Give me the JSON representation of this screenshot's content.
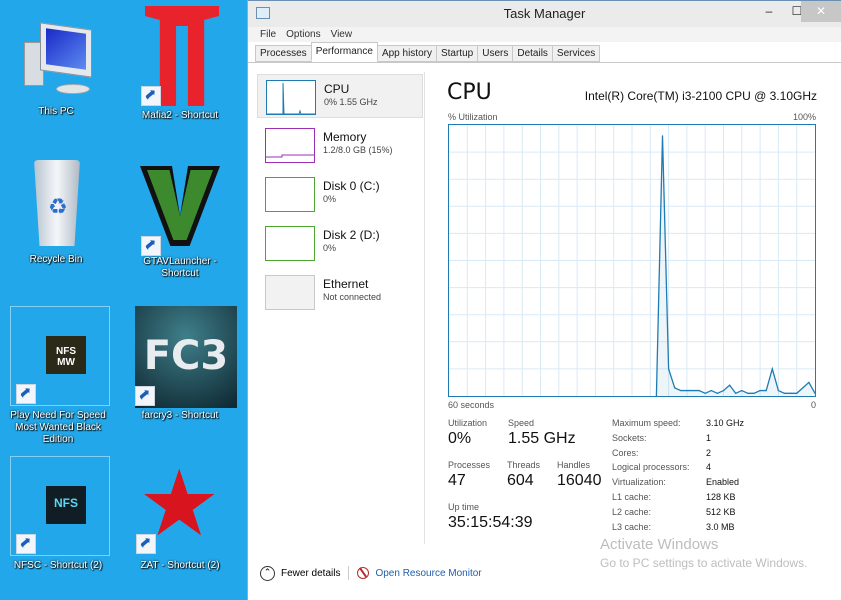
{
  "desktop": {
    "icons": [
      {
        "label": "This PC",
        "icon": "this-pc-icon"
      },
      {
        "label": "Mafia2 - Shortcut",
        "icon": "mafia2-icon"
      },
      {
        "label": "Recycle Bin",
        "icon": "recycle-bin-icon"
      },
      {
        "label": "GTAVLauncher - Shortcut",
        "icon": "gtav-icon"
      },
      {
        "label": "Play Need For Speed Most Wanted Black Edition",
        "icon": "nfs-mw-icon",
        "thumb_text": "NFS MW"
      },
      {
        "label": "farcry3 - Shortcut",
        "icon": "farcry3-icon",
        "thumb_text": "FC3"
      },
      {
        "label": "NFSC - Shortcut (2)",
        "icon": "nfsc-icon",
        "thumb_text": "NFS"
      },
      {
        "label": "ZAT - Shortcut (2)",
        "icon": "pentagram-icon"
      }
    ]
  },
  "window": {
    "title": "Task Manager",
    "controls": {
      "minimize": "–",
      "maximize": "☐",
      "close": "✕"
    },
    "menu": [
      "File",
      "Options",
      "View"
    ],
    "tabs": [
      "Processes",
      "Performance",
      "App history",
      "Startup",
      "Users",
      "Details",
      "Services"
    ],
    "active_tab": "Performance"
  },
  "resources": [
    {
      "name": "CPU",
      "sub": "0% 1.55 GHz",
      "color": "#1e7bb4"
    },
    {
      "name": "Memory",
      "sub": "1.2/8.0 GB (15%)",
      "color": "#9b30b4"
    },
    {
      "name": "Disk 0 (C:)",
      "sub": "0%",
      "color": "#4da62f"
    },
    {
      "name": "Disk 2 (D:)",
      "sub": "0%",
      "color": "#4da62f"
    },
    {
      "name": "Ethernet",
      "sub": "Not connected",
      "color": "#c8c8c8"
    }
  ],
  "cpu": {
    "heading": "CPU",
    "model": "Intel(R) Core(TM) i3-2100 CPU @ 3.10GHz",
    "y_label": "% Utilization",
    "y_max_label": "100%",
    "x_left_label": "60 seconds",
    "x_right_label": "0",
    "stats": {
      "utilization": {
        "label": "Utilization",
        "value": "0%"
      },
      "speed": {
        "label": "Speed",
        "value": "1.55 GHz"
      },
      "processes": {
        "label": "Processes",
        "value": "47"
      },
      "threads": {
        "label": "Threads",
        "value": "604"
      },
      "handles": {
        "label": "Handles",
        "value": "16040"
      },
      "uptime": {
        "label": "Up time",
        "value": "35:15:54:39"
      }
    },
    "specs": [
      {
        "k": "Maximum speed:",
        "v": "3.10 GHz"
      },
      {
        "k": "Sockets:",
        "v": "1"
      },
      {
        "k": "Cores:",
        "v": "2"
      },
      {
        "k": "Logical processors:",
        "v": "4"
      },
      {
        "k": "Virtualization:",
        "v": "Enabled"
      },
      {
        "k": "L1 cache:",
        "v": "128 KB"
      },
      {
        "k": "L2 cache:",
        "v": "512 KB"
      },
      {
        "k": "L3 cache:",
        "v": "3.0 MB"
      }
    ]
  },
  "chart_data": {
    "type": "area",
    "title": "CPU % Utilization",
    "xlabel": "60 seconds",
    "ylabel": "% Utilization",
    "xlim": [
      60,
      0
    ],
    "ylim": [
      0,
      100
    ],
    "grid": true,
    "series": [
      {
        "name": "CPU",
        "x": [
          26,
          25,
          24,
          23,
          22,
          21,
          20,
          19,
          18,
          17,
          16,
          15,
          14,
          13,
          12,
          11,
          10,
          9,
          8,
          7,
          6,
          5,
          4,
          3,
          2,
          1,
          0
        ],
        "values": [
          0,
          96,
          10,
          3,
          2,
          2,
          2,
          2,
          1,
          2,
          1,
          2,
          4,
          1,
          2,
          1,
          1,
          2,
          2,
          10,
          2,
          1,
          1,
          1,
          3,
          5,
          1
        ]
      }
    ]
  },
  "footer": {
    "fewer_details": "Fewer details",
    "open_resource_monitor": "Open Resource Monitor"
  },
  "watermark": {
    "title": "Activate Windows",
    "subtitle": "Go to PC settings to activate Windows."
  }
}
